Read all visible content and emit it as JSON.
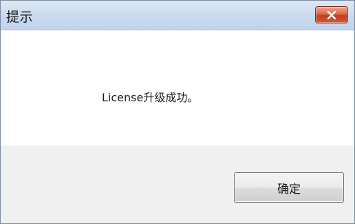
{
  "window": {
    "title": "提示",
    "close_icon": "close-icon"
  },
  "message": {
    "text": "License升级成功。"
  },
  "buttons": {
    "ok_label": "确定"
  },
  "colors": {
    "close_button": "#c43e20",
    "footer_background": "#f0f0f0"
  }
}
